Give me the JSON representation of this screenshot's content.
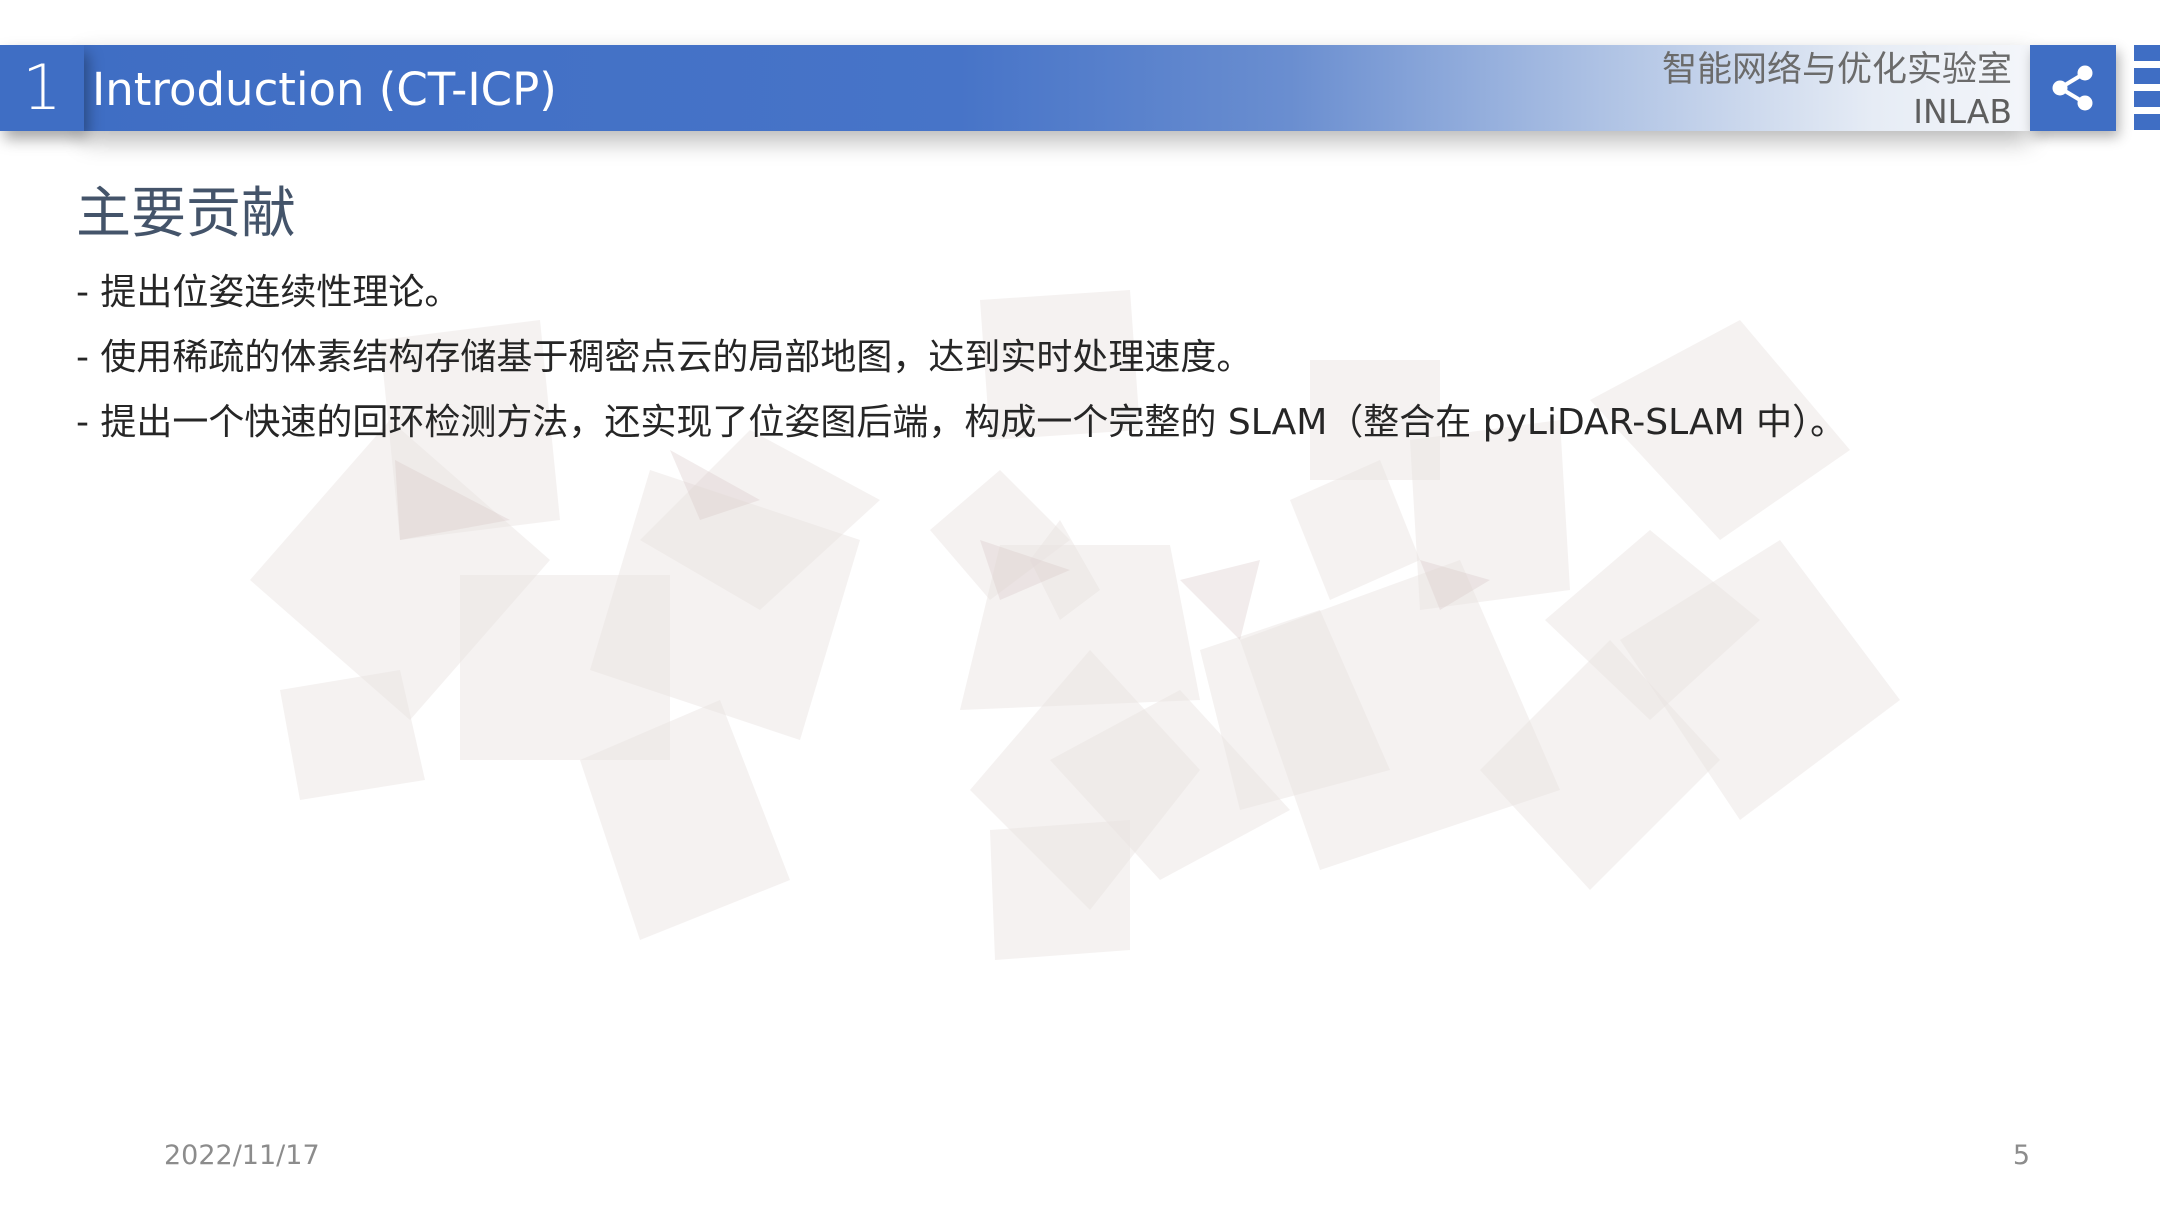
{
  "header": {
    "section_number": "1",
    "title": "Introduction (CT-ICP)",
    "lab_name": "智能网络与优化实验室",
    "lab_abbr": "INLAB",
    "share_icon": "share-icon"
  },
  "content": {
    "heading": "主要贡献",
    "bullets": [
      "- 提出位姿连续性理论。",
      "- 使用稀疏的体素结构存储基于稠密点云的局部地图，达到实时处理速度。",
      "- 提出一个快速的回环检测方法，还实现了位姿图后端，构成一个完整的 SLAM（整合在 pyLiDAR-SLAM 中）。"
    ]
  },
  "footer": {
    "date": "2022/11/17",
    "page_number": "5"
  },
  "colors": {
    "banner_blue": "#3f6ec4",
    "heading_color": "#44546a",
    "text_color": "#262626",
    "footer_gray": "#8c8c8c"
  }
}
